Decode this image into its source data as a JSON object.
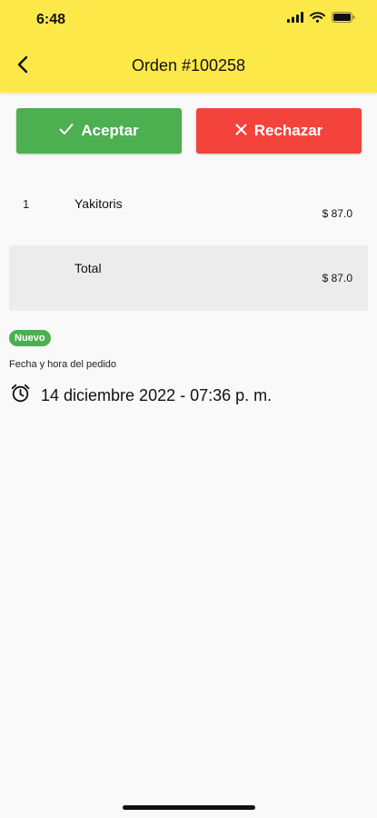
{
  "status_bar": {
    "time": "6:48",
    "icons": [
      "signal-icon",
      "wifi-icon",
      "battery-icon"
    ]
  },
  "header": {
    "back_icon": "chevron-left-icon",
    "title": "Orden #100258"
  },
  "actions": {
    "accept": {
      "label": "Aceptar",
      "icon": "check-icon",
      "color": "#4caf50"
    },
    "reject": {
      "label": "Rechazar",
      "icon": "close-icon",
      "color": "#f4433b"
    }
  },
  "order": {
    "items": [
      {
        "qty": "1",
        "name": "Yakitoris",
        "price": "$ 87.0"
      }
    ],
    "total": {
      "label": "Total",
      "price": "$ 87.0"
    }
  },
  "status": {
    "badge": "Nuevo",
    "badge_color": "#4caf50"
  },
  "date": {
    "label": "Fecha y hora del pedido",
    "icon": "alarm-clock-icon",
    "value": "14 diciembre 2022 - 07:36 p. m."
  },
  "colors": {
    "header_bg": "#fde84a",
    "page_bg": "#f9f9f9",
    "total_row_bg": "#ececec"
  }
}
